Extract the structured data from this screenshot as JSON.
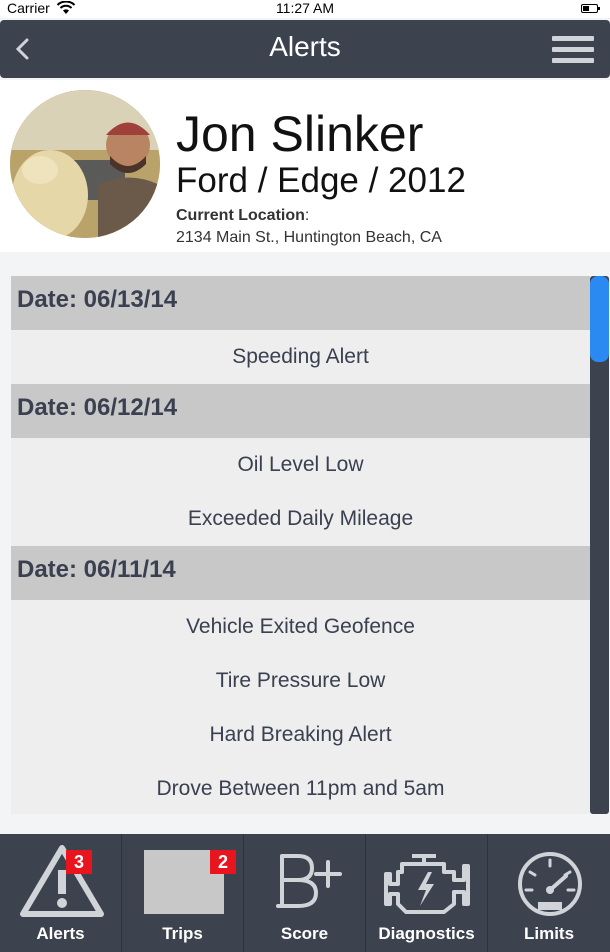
{
  "status_bar": {
    "carrier": "Carrier",
    "time": "11:27 AM"
  },
  "nav": {
    "title": "Alerts",
    "back_icon": "chevron-left-icon",
    "menu_icon": "hamburger-menu-icon"
  },
  "profile": {
    "name": "Jon Slinker",
    "vehicle": "Ford / Edge / 2012",
    "location_label": "Current Location",
    "location_colon": ":",
    "location_value": "2134 Main St., Huntington Beach, CA"
  },
  "alert_groups": [
    {
      "date": "Date: 06/13/14",
      "alerts": [
        "Speeding Alert"
      ]
    },
    {
      "date": "Date: 06/12/14",
      "alerts": [
        "Oil Level Low",
        "Exceeded Daily Mileage"
      ]
    },
    {
      "date": "Date: 06/11/14",
      "alerts": [
        "Vehicle Exited Geofence",
        "Tire Pressure Low",
        "Hard Breaking Alert",
        "Drove Between 11pm and 5am"
      ]
    }
  ],
  "tabs": [
    {
      "label": "Alerts",
      "icon": "warning-triangle-icon",
      "badge": "3"
    },
    {
      "label": "Trips",
      "icon": "trips-image",
      "badge": "2"
    },
    {
      "label": "Score",
      "icon": "grade-b-plus-icon",
      "badge": null
    },
    {
      "label": "Diagnostics",
      "icon": "engine-icon",
      "badge": null
    },
    {
      "label": "Limits",
      "icon": "speedometer-icon",
      "badge": null
    }
  ],
  "colors": {
    "nav_bg": "#3c434f",
    "scroll_thumb": "#2a8af2",
    "badge": "#e8141e",
    "date_row": "#c8c8c8"
  }
}
